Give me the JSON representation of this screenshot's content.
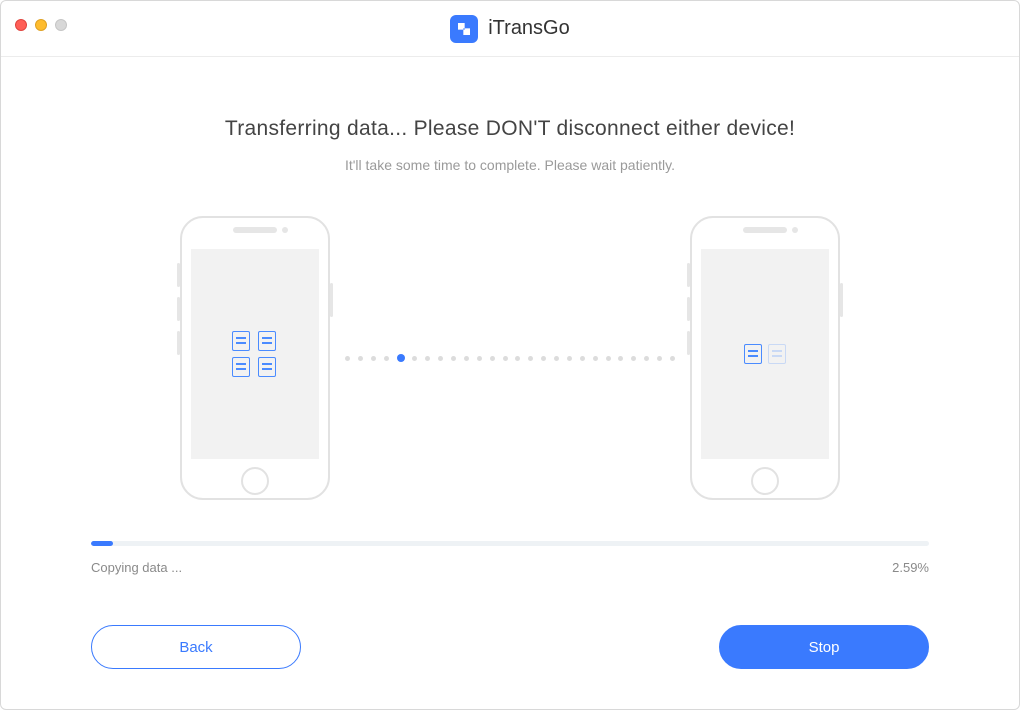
{
  "app": {
    "name": "iTransGo"
  },
  "main": {
    "heading": "Transferring data... Please DON'T disconnect either device!",
    "subheading": "It'll take some time to complete. Please wait patiently."
  },
  "progress": {
    "status_text": "Copying data ...",
    "percent_text": "2.59%",
    "percent_value": 2.59
  },
  "buttons": {
    "back": "Back",
    "stop": "Stop"
  },
  "colors": {
    "accent": "#3a7afe"
  }
}
